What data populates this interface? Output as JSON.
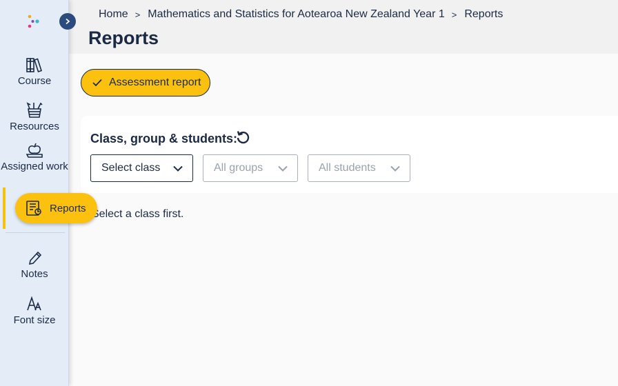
{
  "sidebar": {
    "items": [
      {
        "label": "Course",
        "icon": "books-icon"
      },
      {
        "label": "Resources",
        "icon": "pencil-cup-icon"
      },
      {
        "label": "Assigned work",
        "icon": "apple-book-icon"
      },
      {
        "label": "Reports",
        "icon": "report-icon",
        "active": true
      },
      {
        "label": "Notes",
        "icon": "pencil-icon"
      },
      {
        "label": "Font size",
        "icon": "font-size-icon"
      }
    ]
  },
  "breadcrumb": {
    "home": "Home",
    "course": "Mathematics and Statistics for Aotearoa New Zealand Year 1",
    "current": "Reports"
  },
  "page": {
    "title": "Reports",
    "assessment_button": "Assessment report",
    "filter_label": "Class, group & students:",
    "select_class": "Select class",
    "all_groups": "All groups",
    "all_students": "All students",
    "empty_message": "Select a class first."
  },
  "colors": {
    "accent": "#fcc10f",
    "navy": "#1b2a44",
    "sidebar_bg": "#e3ecf7"
  }
}
